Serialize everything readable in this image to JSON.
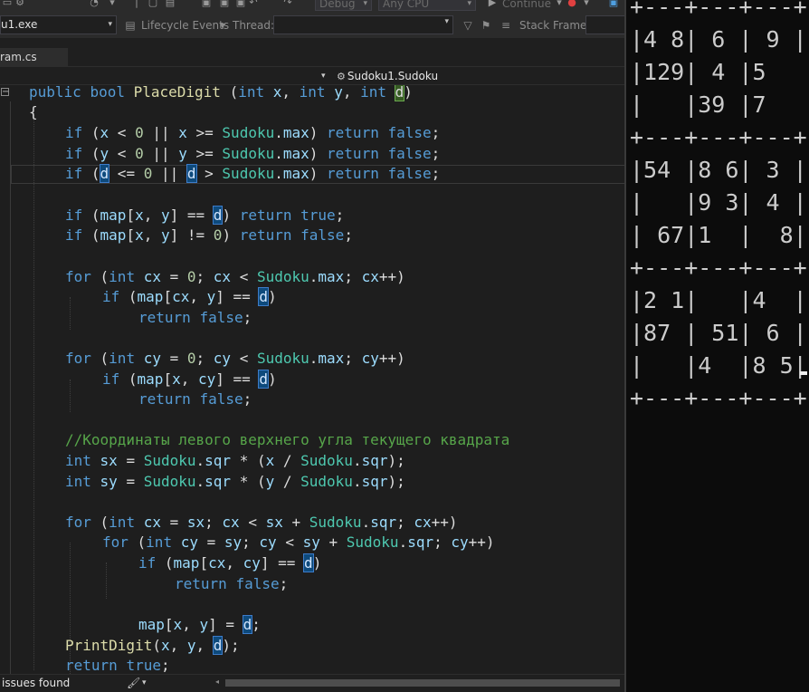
{
  "toolbar": {
    "config_combo": "Debug",
    "platform_combo": "Any CPU",
    "continue_label": "Continue"
  },
  "debug_toolbar": {
    "process": "u1.exe",
    "lifecycle_label": "Lifecycle Events",
    "thread_label": "Thread:",
    "stack_frame_label": "Stack Frame:"
  },
  "tabs": [
    {
      "label": "ram.cs"
    }
  ],
  "navbar": {
    "member": "Sudoku1.Sudoku"
  },
  "code": {
    "lines": [
      "public bool PlaceDigit (int x, int y, int d)",
      "{",
      "if (x < 0 || x >= Sudoku.max) return false;",
      "if (y < 0 || y >= Sudoku.max) return false;",
      "if (d <= 0 || d > Sudoku.max) return false;",
      "",
      "if (map[x, y] == d) return true;",
      "if (map[x, y] != 0) return false;",
      "",
      "for (int cx = 0; cx < Sudoku.max; cx++)",
      "if (map[cx, y] == d)",
      "return false;",
      "",
      "for (int cy = 0; cy < Sudoku.max; cy++)",
      "if (map[x, cy] == d)",
      "return false;",
      "",
      "//Координаты левого верхнего угла текущего квадрата",
      "int sx = Sudoku.sqr * (x / Sudoku.sqr);",
      "int sy = Sudoku.sqr * (y / Sudoku.sqr);",
      "",
      "for (int cx = sx; cx < sx + Sudoku.sqr; cx++)",
      "for (int cy = sy; cy < sy + Sudoku.sqr; cy++)",
      "if (map[cx, cy] == d)",
      "return false;",
      "",
      "map[x, y] = d;",
      "PrintDigit(x, y, d);",
      "return true;"
    ]
  },
  "status": {
    "issues": "issues found"
  },
  "console": {
    "lines": [
      "+---+---+---+",
      "|4 8| 6 | 9 |",
      "|129| 4 |5   |",
      "|   |39 |7   |",
      "+---+---+---+",
      "|54 |8 6| 3 |",
      "|   |9 3| 4 |",
      "| 67|1  |  8|",
      "+---+---+---+",
      "|2 1|   |4  |",
      "|87 | 51| 6 |",
      "|   |4  |8 5|",
      "+---+---+---+"
    ]
  },
  "colors": {
    "keyword": "#569cd6",
    "type": "#4ec9b0",
    "identifier": "#9cdcfe",
    "method": "#dcdcaa",
    "number": "#b5cea8",
    "comment": "#57a64a",
    "highlight": "#0e4a7c"
  },
  "icons": [
    "undo-icon",
    "redo-icon",
    "continue-icon",
    "breakpoint-icon",
    "lifecycle-icon",
    "filter-icon",
    "stack-icon",
    "method-icon",
    "brush-icon"
  ]
}
